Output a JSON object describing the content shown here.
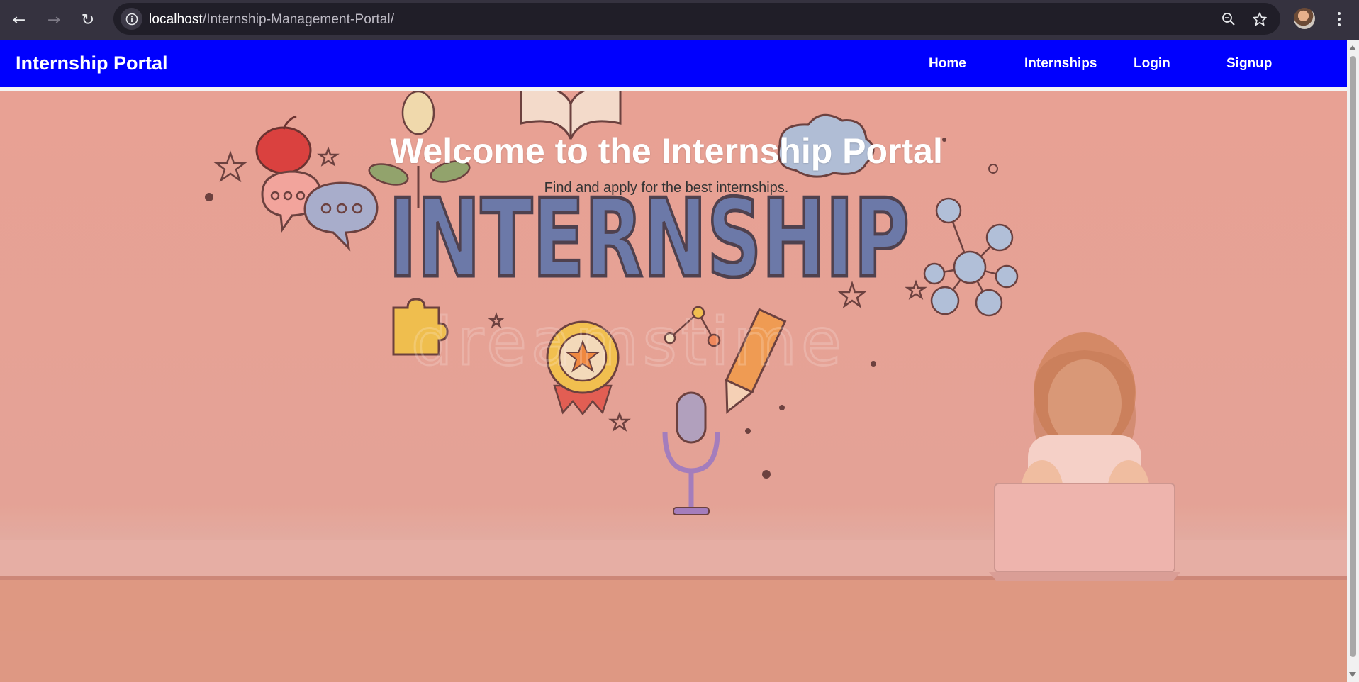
{
  "browser": {
    "url_host": "localhost",
    "url_path": "/Internship-Management-Portal/",
    "back_icon": "arrow-left-icon",
    "forward_icon": "arrow-right-icon",
    "reload_icon": "reload-icon",
    "site_info_icon": "info-icon",
    "zoom_icon": "magnifier-icon",
    "bookmark_icon": "star-icon",
    "menu_icon": "kebab-icon"
  },
  "navbar": {
    "brand": "Internship Portal",
    "links": [
      "Home",
      "Internships",
      "Login",
      "Signup"
    ],
    "background": "#0000fe"
  },
  "hero": {
    "title": "Welcome to the Internship Portal",
    "subtitle": "Find and apply for the best internships.",
    "illustration_word": "INTERNSHIP",
    "watermark": "dreamstime"
  }
}
